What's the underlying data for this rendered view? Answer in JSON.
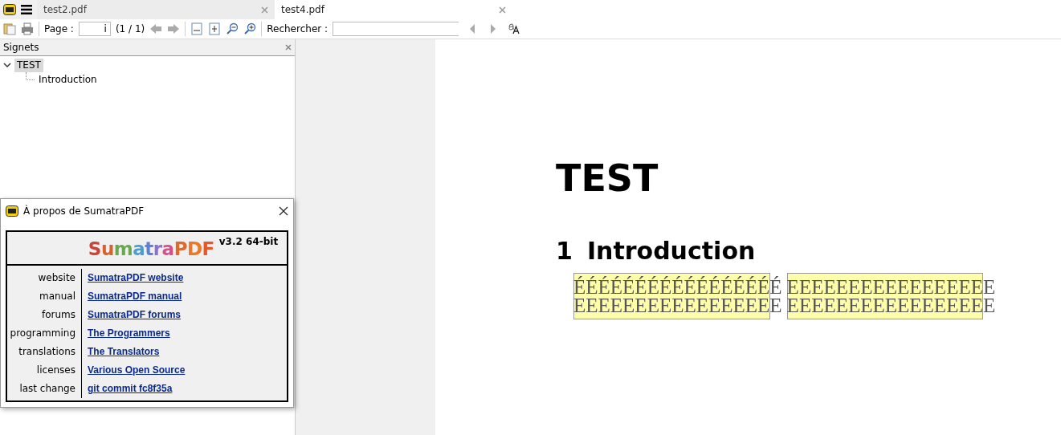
{
  "tabs": [
    {
      "label": "test2.pdf",
      "selected": false
    },
    {
      "label": "test4.pdf",
      "selected": true
    }
  ],
  "toolbar": {
    "page_label": "Page :",
    "page_value": "i",
    "page_count": "(1 / 1)",
    "search_label": "Rechercher :"
  },
  "sidebar": {
    "title": "Signets",
    "tree": [
      {
        "label": "TEST",
        "expanded": true,
        "selected": true,
        "children": [
          {
            "label": "Introduction",
            "selected": false
          }
        ]
      }
    ]
  },
  "document": {
    "title": "TEST",
    "section_number": "1",
    "section_title": "Introduction",
    "columns": [
      {
        "highlighted": true,
        "lines": [
          "ÉÉÉÉÉÉÉÉÉÉÉÉÉÉÉÉÉ",
          "EEEEEEEEEEEEEEEEE"
        ]
      },
      {
        "highlighted": true,
        "lines": [
          "EEEEEEEEEEEEEEEEE",
          "EEEEEEEEEEEEEEEEE"
        ]
      }
    ]
  },
  "about_dialog": {
    "title": "À propos de SumatraPDF",
    "logo": "SumatraPDF",
    "version": "v3.2 64-bit",
    "rows": [
      {
        "label": "website",
        "link": "SumatraPDF website"
      },
      {
        "label": "manual",
        "link": "SumatraPDF manual"
      },
      {
        "label": "forums",
        "link": "SumatraPDF forums"
      },
      {
        "label": "programming",
        "link": "The Programmers"
      },
      {
        "label": "translations",
        "link": "The Translators"
      },
      {
        "label": "licenses",
        "link": "Various Open Source"
      },
      {
        "label": "last change",
        "link": "git commit fc8f35a"
      }
    ]
  }
}
